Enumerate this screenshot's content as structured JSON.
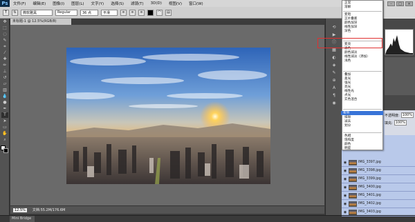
{
  "app": {
    "logo": "Ps",
    "menus": [
      "文件(F)",
      "编辑(E)",
      "图像(I)",
      "图层(L)",
      "文字(Y)",
      "选择(S)",
      "滤镜(T)",
      "3D(D)",
      "视图(V)",
      "窗口(W)"
    ]
  },
  "options": {
    "tool_icon": "T",
    "font_family": "微软雅黑",
    "font_style": "Regular",
    "font_size": "36 点",
    "anti_alias": "平滑"
  },
  "document": {
    "tab_label": "未标题-1 @ 12.5%(RGB/8)"
  },
  "status": {
    "zoom": "12.5%",
    "doc_info": "文档:55.2M/176.6M"
  },
  "minibridge": {
    "tab_label": "Mini Bridge"
  },
  "blend_menu": {
    "options": [
      "正常",
      "溶解",
      "变暗",
      "正片叠底",
      "颜色加深",
      "线性加深",
      "深色",
      "变亮",
      "滤色",
      "颜色减淡",
      "线性减淡（添加）",
      "浅色",
      "叠加",
      "柔光",
      "强光",
      "亮光",
      "线性光",
      "点光",
      "实色混合",
      "差值",
      "排除",
      "减去",
      "划分",
      "色相",
      "饱和度",
      "颜色",
      "明度"
    ],
    "selected": "差值",
    "highlighted": "变亮"
  },
  "layers_panel": {
    "opacity_label": "不透明度:",
    "opacity_value": "100%",
    "fill_label": "填充:",
    "fill_value": "100%",
    "layers": [
      "IMG_3397.jpg",
      "IMG_3398.jpg",
      "IMG_3399.jpg",
      "IMG_3400.jpg",
      "IMG_3401.jpg",
      "IMG_3402.jpg",
      "IMG_3403.jpg"
    ]
  },
  "colors": {
    "highlight": "#3874d8",
    "annotation_box": "#e03030",
    "layers_bg": "#b9c9ea"
  }
}
